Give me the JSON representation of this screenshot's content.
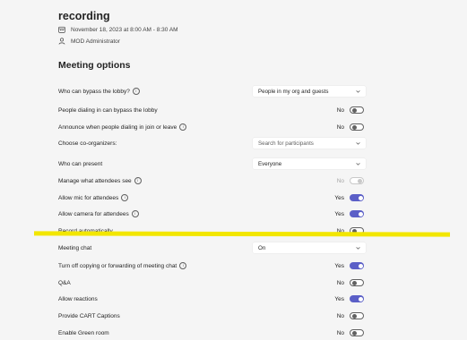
{
  "meeting": {
    "title": "recording",
    "datetime": "November 18, 2023 at 8:00 AM - 8:30 AM",
    "organizer": "MOD Administrator"
  },
  "section_title": "Meeting options",
  "options": {
    "bypass_lobby": {
      "label": "Who can bypass the lobby?",
      "value": "People in my org and guests"
    },
    "dial_in_bypass": {
      "label": "People dialing in can bypass the lobby",
      "state": "No"
    },
    "announce": {
      "label": "Announce when people dialing in join or leave",
      "state": "No"
    },
    "co_organizers": {
      "label": "Choose co-organizers:",
      "placeholder": "Search for participants"
    },
    "who_can_present": {
      "label": "Who can present",
      "value": "Everyone"
    },
    "manage_see": {
      "label": "Manage what attendees see",
      "state": "No"
    },
    "allow_mic": {
      "label": "Allow mic for attendees",
      "state": "Yes"
    },
    "allow_camera": {
      "label": "Allow camera for attendees",
      "state": "Yes"
    },
    "record_auto": {
      "label": "Record automatically",
      "state": "No"
    },
    "meeting_chat": {
      "label": "Meeting chat",
      "value": "On"
    },
    "turn_off_copying": {
      "label": "Turn off copying or forwarding of meeting chat",
      "state": "Yes"
    },
    "qa": {
      "label": "Q&A",
      "state": "No"
    },
    "reactions": {
      "label": "Allow reactions",
      "state": "Yes"
    },
    "cart": {
      "label": "Provide CART Captions",
      "state": "No"
    },
    "green_room": {
      "label": "Enable Green room",
      "state": "No"
    }
  },
  "colors": {
    "accent": "#5b5fc7",
    "highlight": "#f2e600"
  },
  "icons": {
    "calendar": "calendar-icon",
    "person": "person-icon",
    "info": "info-icon",
    "chevron": "chevron-down-icon"
  }
}
